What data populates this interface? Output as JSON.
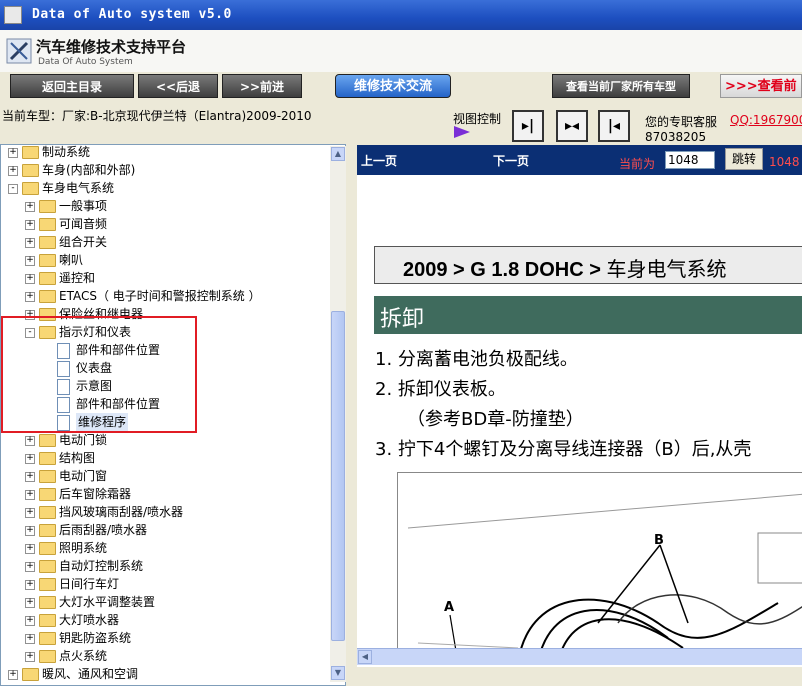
{
  "window": {
    "title": "Data of Auto system v5.0"
  },
  "header": {
    "title_cn": "汽车维修技术支持平台",
    "title_en": "Data Of Auto System"
  },
  "nav": {
    "home": "返回主目录",
    "back": "<<后退",
    "forward": ">>前进",
    "exchange": "维修技术交流",
    "view_all": "查看当前厂家所有车型",
    "view_more": ">>>查看前"
  },
  "info": {
    "current_car": "当前车型：厂家:B-北京现代伊兰特（Elantra)2009-2010",
    "view_control": "视图控制",
    "service": "您的专职客服",
    "qq": "QQ:1967900",
    "phone": "87038205"
  },
  "tree": {
    "items": [
      {
        "label": "制动系统"
      },
      {
        "label": "车身(内部和外部)"
      },
      {
        "label": "车身电气系统"
      },
      {
        "label": "一般事项"
      },
      {
        "label": "可闻音频"
      },
      {
        "label": "组合开关"
      },
      {
        "label": "喇叭"
      },
      {
        "label": "遥控和"
      },
      {
        "label": "ETACS（ 电子时间和警报控制系统 ）"
      },
      {
        "label": "保险丝和继电器"
      },
      {
        "label": "指示灯和仪表"
      },
      {
        "label": "部件和部件位置"
      },
      {
        "label": "仪表盘"
      },
      {
        "label": "示意图"
      },
      {
        "label": "部件和部件位置"
      },
      {
        "label": "维修程序"
      },
      {
        "label": "电动门锁"
      },
      {
        "label": "结构图"
      },
      {
        "label": "电动门窗"
      },
      {
        "label": "后车窗除霜器"
      },
      {
        "label": "挡风玻璃雨刮器/喷水器"
      },
      {
        "label": "后雨刮器/喷水器"
      },
      {
        "label": "照明系统"
      },
      {
        "label": "自动灯控制系统"
      },
      {
        "label": "日间行车灯"
      },
      {
        "label": "大灯水平调整装置"
      },
      {
        "label": "大灯喷水器"
      },
      {
        "label": "钥匙防盗系统"
      },
      {
        "label": "点火系统"
      },
      {
        "label": "暖风、通风和空调"
      }
    ]
  },
  "viewer": {
    "prev": "上一页",
    "next": "下一页",
    "current_label": "当前为",
    "page": "1048",
    "go": "跳转",
    "total": "1048 ."
  },
  "document": {
    "title_bold": "2009 > G 1.8 DOHC >",
    "title_rest": " 车身电气系统",
    "section": "拆卸",
    "step1": "1. 分离蓄电池负极配线。",
    "step2": "2. 拆卸仪表板。",
    "step2b": "（参考BD章-防撞垫）",
    "step3": "3. 拧下4个螺钉及分离导线连接器（B）后,从壳",
    "label_a": "A",
    "label_b": "B"
  }
}
